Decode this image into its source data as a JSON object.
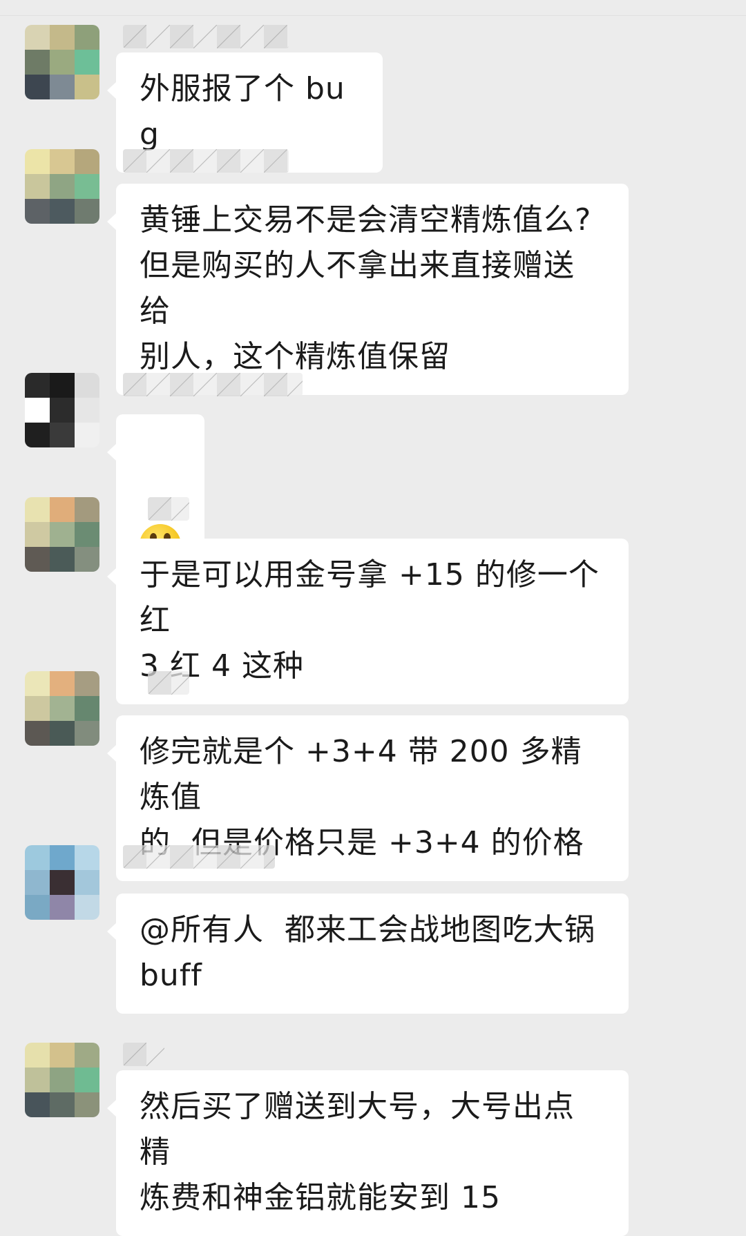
{
  "messages": [
    {
      "sender": "",
      "text": "外服报了个 bug",
      "avatar_colors": [
        "#d9d3b3",
        "#c4b98a",
        "#8ea07a",
        "#6e7b66",
        "#9aaa80",
        "#6dbf98",
        "#3d4650",
        "#7e8a94",
        "#c9c08a"
      ]
    },
    {
      "sender": "",
      "text": "黄锤上交易不是会清空精炼值么?\n但是购买的人不拿出来直接赠送给\n别人，这个精炼值保留",
      "avatar_colors": [
        "#ece4a8",
        "#d8c792",
        "#b5a77c",
        "#c9c69c",
        "#8fa584",
        "#78bd93",
        "#5d6266",
        "#4d5a5f",
        "#6f7b6f"
      ]
    },
    {
      "sender": "",
      "text": "",
      "emoji": "grimacing-face",
      "avatar_colors": [
        "#2a2a2a",
        "#1a1a1a",
        "#dcdcdc",
        "#ffffff",
        "#2c2c2c",
        "#e6e6e6",
        "#1f1f1f",
        "#3a3a3a",
        "#f0f0f0"
      ]
    },
    {
      "sender": "",
      "text": "于是可以用金号拿 +15 的修一个红\n3 红 4 这种",
      "avatar_colors": [
        "#e8e2b0",
        "#e0ad7a",
        "#a39a7e",
        "#cfc9a2",
        "#9fb190",
        "#6b8c73",
        "#5f5a54",
        "#4b5b58",
        "#848f7f"
      ]
    },
    {
      "sender": "",
      "text": "修完就是个 +3+4 带 200 多精炼值\n的  但是价格只是 +3+4 的价格",
      "avatar_colors": [
        "#ebe6b8",
        "#e3b07e",
        "#a69d82",
        "#cdc8a0",
        "#a2b392",
        "#66876f",
        "#5c5853",
        "#4a5a56",
        "#818c7d"
      ]
    },
    {
      "sender": "",
      "text": "@所有人  都来工会战地图吃大锅\nbuff",
      "avatar_colors": [
        "#9dc9de",
        "#6fa8cc",
        "#b7d7e8",
        "#8fb7cf",
        "#3a2f33",
        "#a3c7db",
        "#7aa9c4",
        "#8f86a8",
        "#c2d9e6"
      ]
    },
    {
      "sender": "",
      "text": "然后买了赠送到大号，大号出点精\n炼费和神金铝就能安到 15",
      "avatar_colors": [
        "#e6e0ac",
        "#d3c18c",
        "#9faa86",
        "#bfc19a",
        "#8ea483",
        "#6fbb92",
        "#48545a",
        "#5e6b64",
        "#8b927a"
      ]
    }
  ]
}
